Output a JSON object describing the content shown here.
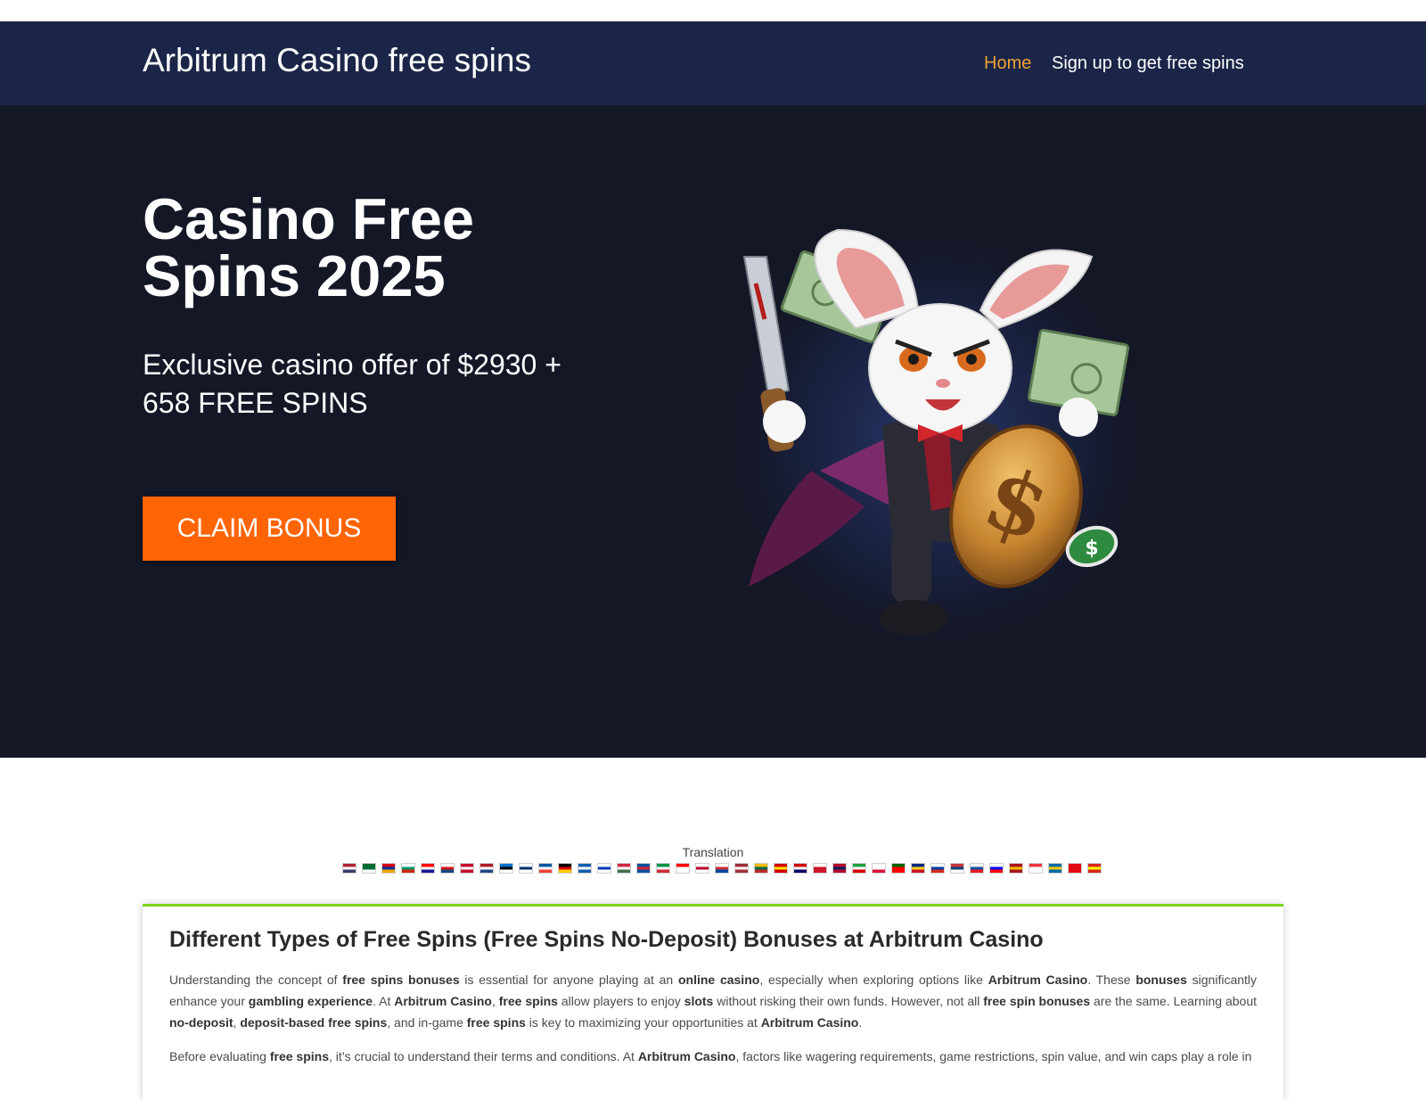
{
  "nav": {
    "brand": "Arbitrum Casino free spins",
    "home": "Home",
    "signup": "Sign up to get free spins",
    "home_color": "#f0a132",
    "background": "#1b2548"
  },
  "hero": {
    "title": "Casino Free Spins 2025",
    "subtitle": "Exclusive casino offer of $2930 + 658 FREE SPINS",
    "cta": "CLAIM BONUS",
    "cta_color": "#ff6405",
    "background": "#141726",
    "image": "rabbit-vampire-mascot with knife, dollar bills and gold coin"
  },
  "translation": {
    "label": "Translation",
    "flags": [
      "us",
      "sa",
      "am",
      "bg",
      "hr",
      "cz",
      "dk",
      "nl",
      "ee",
      "fi",
      "fr",
      "de",
      "gr",
      "il",
      "hu",
      "is",
      "it",
      "id",
      "jp",
      "kr",
      "lv",
      "lt",
      "mk",
      "my",
      "mt",
      "no",
      "ir",
      "pl",
      "pt",
      "ro",
      "ru",
      "rs",
      "sk",
      "si",
      "es",
      "sg",
      "se",
      "tr",
      "vn"
    ]
  },
  "article": {
    "accent_color": "#7ed321",
    "heading": "Different Types of Free Spins (Free Spins No-Deposit) Bonuses at Arbitrum Casino",
    "p1": [
      {
        "t": "Understanding the concept of "
      },
      {
        "t": "free spins bonuses",
        "b": true
      },
      {
        "t": " is essential for anyone playing at an "
      },
      {
        "t": "online casino",
        "b": true
      },
      {
        "t": ", especially when exploring options like "
      },
      {
        "t": "Arbitrum Casino",
        "b": true
      },
      {
        "t": ". These "
      },
      {
        "t": "bonuses",
        "b": true
      },
      {
        "t": " significantly enhance your "
      },
      {
        "t": "gambling experience",
        "b": true
      },
      {
        "t": ". At "
      },
      {
        "t": "Arbitrum Casino",
        "b": true
      },
      {
        "t": ", "
      },
      {
        "t": "free spins",
        "b": true
      },
      {
        "t": " allow players to enjoy "
      },
      {
        "t": "slots",
        "b": true
      },
      {
        "t": " without risking their own funds. However, not all "
      },
      {
        "t": "free spin bonuses",
        "b": true
      },
      {
        "t": " are the same. Learning about "
      },
      {
        "t": "no-deposit",
        "b": true
      },
      {
        "t": ", "
      },
      {
        "t": "deposit-based free spins",
        "b": true
      },
      {
        "t": ", and in-game "
      },
      {
        "t": "free spins",
        "b": true
      },
      {
        "t": " is key to maximizing your opportunities at "
      },
      {
        "t": "Arbitrum Casino",
        "b": true
      },
      {
        "t": "."
      }
    ],
    "p2": [
      {
        "t": "Before evaluating "
      },
      {
        "t": "free spins",
        "b": true
      },
      {
        "t": ", it’s crucial to understand their terms and conditions. At "
      },
      {
        "t": "Arbitrum Casino",
        "b": true
      },
      {
        "t": ", factors like wagering requirements, game restrictions, spin value, and win caps play a role in"
      }
    ]
  }
}
